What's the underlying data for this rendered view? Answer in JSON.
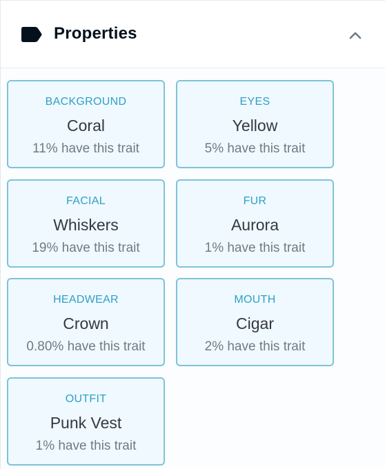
{
  "header": {
    "title": "Properties",
    "icon": "tag-icon",
    "toggle_icon": "chevron-up-icon"
  },
  "colors": {
    "card_background": "#eff9ff",
    "card_border": "#7fc3d6",
    "trait_type": "#2f9fc6",
    "trait_value": "#353840",
    "trait_rarity": "#707a83"
  },
  "traits": [
    {
      "type": "BACKGROUND",
      "value": "Coral",
      "rarity": "11% have this trait"
    },
    {
      "type": "EYES",
      "value": "Yellow",
      "rarity": "5% have this trait"
    },
    {
      "type": "FACIAL",
      "value": "Whiskers",
      "rarity": "19% have this trait"
    },
    {
      "type": "FUR",
      "value": "Aurora",
      "rarity": "1% have this trait"
    },
    {
      "type": "HEADWEAR",
      "value": "Crown",
      "rarity": "0.80% have this trait"
    },
    {
      "type": "MOUTH",
      "value": "Cigar",
      "rarity": "2% have this trait"
    },
    {
      "type": "OUTFIT",
      "value": "Punk Vest",
      "rarity": "1% have this trait"
    }
  ]
}
